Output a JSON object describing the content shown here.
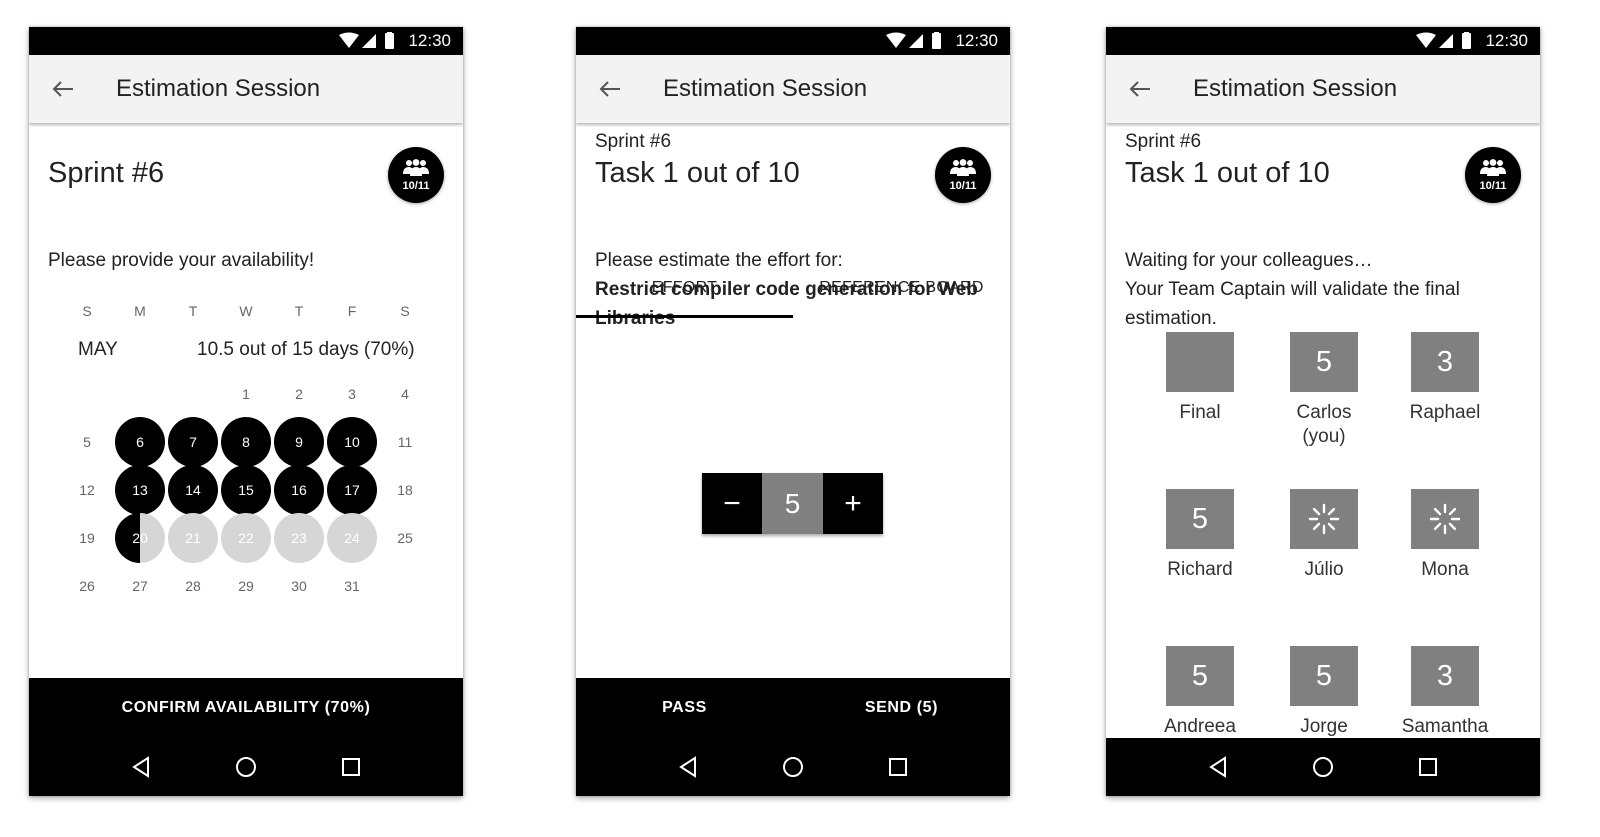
{
  "status_time": "12:30",
  "screens": [
    {
      "app_title": "Estimation Session",
      "heading": "Sprint #6",
      "team_count": "10/11",
      "prompt": "Please provide your availability!",
      "calendar": {
        "dow": [
          "S",
          "M",
          "T",
          "W",
          "T",
          "F",
          "S"
        ],
        "month": "MAY",
        "summary": "10.5 out of 15 days (70%)",
        "selected": [
          6,
          7,
          8,
          9,
          10,
          13,
          14,
          15,
          16,
          17
        ],
        "half_selected": [
          20
        ],
        "pending": [
          21,
          22,
          23,
          24
        ]
      },
      "action": "CONFIRM AVAILABILITY (70%)"
    },
    {
      "app_title": "Estimation Session",
      "sprint": "Sprint #6",
      "task": "Task 1 out of 10",
      "team_count": "10/11",
      "prompt": "Please estimate the effort for:",
      "task_name": "Restrict compiler code generation for Web Libraries",
      "tabs": [
        "EFFORT",
        "REFERENCE BOARD"
      ],
      "active_tab": "EFFORT",
      "stepper": {
        "minus": "−",
        "value": "5",
        "plus": "+"
      },
      "pass_label": "PASS",
      "send_label": "SEND (5)"
    },
    {
      "app_title": "Estimation Session",
      "sprint": "Sprint #6",
      "task": "Task 1 out of 10",
      "team_count": "10/11",
      "waiting": "Waiting for your colleagues…",
      "validate": "Your Team Captain will validate the final estimation.",
      "votes": [
        {
          "name": "Final",
          "value": "",
          "state": "empty"
        },
        {
          "name": "Carlos\n(you)",
          "value": "5",
          "state": "voted"
        },
        {
          "name": "Raphael",
          "value": "3",
          "state": "voted"
        },
        {
          "name": "Richard",
          "value": "5",
          "state": "voted"
        },
        {
          "name": "Júlio",
          "value": "",
          "state": "loading"
        },
        {
          "name": "Mona",
          "value": "",
          "state": "loading"
        },
        {
          "name": "Andreea",
          "value": "5",
          "state": "voted"
        },
        {
          "name": "Jorge",
          "value": "5",
          "state": "voted"
        },
        {
          "name": "Samantha",
          "value": "3",
          "state": "voted"
        }
      ]
    }
  ],
  "icons": {
    "back": "arrow-left-icon",
    "team": "group-icon",
    "nav_back": "nav-back-icon",
    "nav_home": "nav-home-icon",
    "nav_recents": "nav-recents-icon",
    "loading": "spinner-icon"
  }
}
